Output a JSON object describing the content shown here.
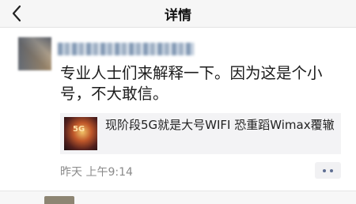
{
  "navbar": {
    "title": "详情",
    "back_icon": "chevron-left-icon"
  },
  "post": {
    "text": "专业人士们来解释一下。因为这是个小\n号，不大敢信。",
    "link_card": {
      "thumbnail_label": "5G",
      "title": "现阶段5G就是大号WIFI 恐重蹈Wimax覆辙"
    },
    "timestamp": "昨天  上午9:14",
    "more_icon": "more-dots-icon"
  },
  "colors": {
    "nav_background": "#f6f6f6",
    "link_card_background": "#f3f3f5",
    "more_dots": "#5f6f93",
    "timestamp": "#8a8a8a"
  }
}
